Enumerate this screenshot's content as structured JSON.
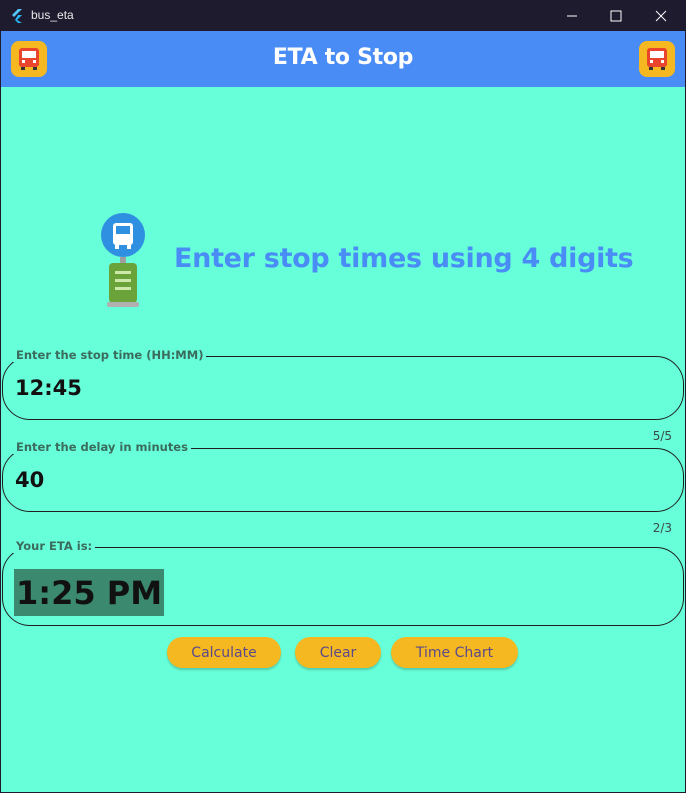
{
  "window": {
    "title": "bus_eta"
  },
  "appbar": {
    "title": "ETA to Stop",
    "left_icon": "bus-icon",
    "right_icon": "bus-icon"
  },
  "hero": {
    "icon": "bus-stop-icon",
    "text": "Enter stop times using 4 digits"
  },
  "fields": {
    "stop_time": {
      "label": "Enter the stop time (HH:MM)",
      "value": "12:45",
      "counter": "5/5"
    },
    "delay": {
      "label": "Enter the delay in minutes",
      "value": "40",
      "counter": "2/3"
    },
    "eta": {
      "label": "Your ETA is:",
      "value": "1:25 PM"
    }
  },
  "buttons": {
    "calculate": "Calculate",
    "clear": "Clear",
    "time_chart": "Time Chart"
  },
  "colors": {
    "background": "#67ffd9",
    "appbar": "#4a8cf5",
    "accent": "#f5b820",
    "eta_highlight": "#3b8a70"
  }
}
